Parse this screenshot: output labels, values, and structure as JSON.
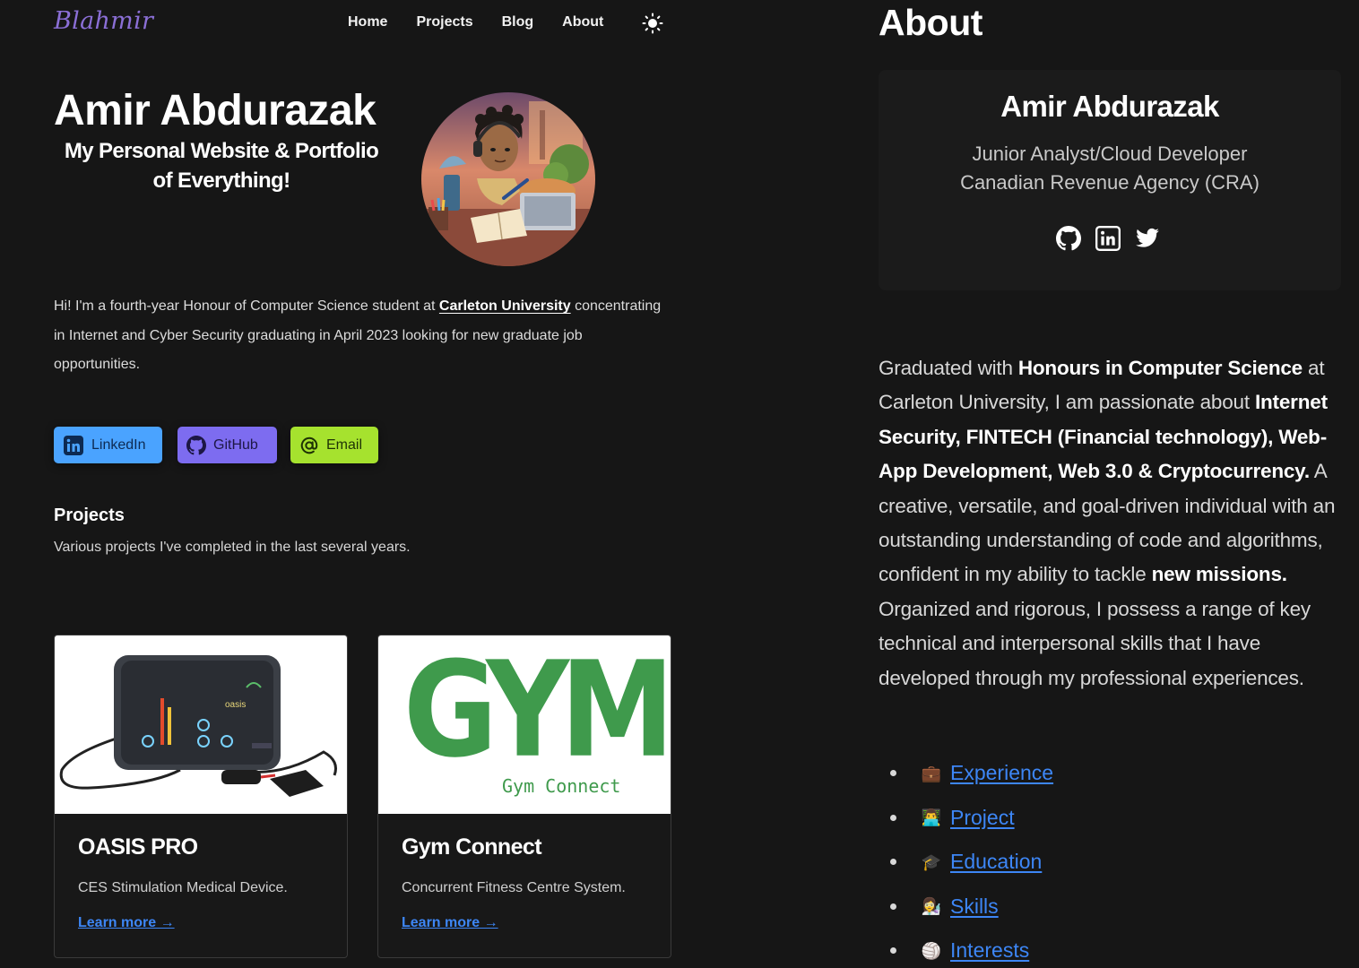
{
  "nav": {
    "brand": "Blahmir",
    "items": [
      "Home",
      "Projects",
      "Blog",
      "About"
    ],
    "theme_icon": "sun-icon"
  },
  "hero": {
    "name": "Amir Abdurazak",
    "subtitle_line1": "My Personal Website & Portfolio",
    "subtitle_line2": "of Everything!",
    "intro_before": "Hi! I'm a fourth-year Honour of Computer Science student at ",
    "intro_link": "Carleton University",
    "intro_after": " concentrating in Internet and Cyber Security graduating in April 2023 looking for new graduate job opportunities."
  },
  "buttons": {
    "linkedin": "LinkedIn",
    "github": "GitHub",
    "email": "Email"
  },
  "projects": {
    "heading": "Projects",
    "description": "Various projects I've completed in the last several years.",
    "cards": [
      {
        "title": "OASIS PRO",
        "description": "CES Stimulation Medical Device.",
        "link": "Learn more →"
      },
      {
        "title": "Gym Connect",
        "description": "Concurrent Fitness Centre System.",
        "link": "Learn more →",
        "logo_text": "GYM",
        "logo_sub": "Gym Connect"
      }
    ]
  },
  "about": {
    "heading": "About",
    "profile": {
      "name": "Amir Abdurazak",
      "role": "Junior Analyst/Cloud Developer",
      "org": "Canadian Revenue Agency (CRA)",
      "icons": [
        "github-icon",
        "linkedin-icon",
        "twitter-icon"
      ]
    },
    "bio": {
      "p1": "Graduated with ",
      "b1": "Honours in Computer Science",
      "p2": " at Carleton University, I am passionate about ",
      "b2": "Internet Security, FINTECH (Financial technology), Web-App Development, Web 3.0 & Cryptocurrency.",
      "p3": " A creative, versatile, and goal-driven individual with an outstanding understanding of code and algorithms, confident in my ability to tackle ",
      "b3": "new missions.",
      "p4": " Organized and rigorous, I possess a range of key technical and interpersonal skills that I have developed through my professional experiences."
    },
    "links": [
      {
        "label": "Experience",
        "emoji": "💼"
      },
      {
        "label": "Project",
        "emoji": "👨‍💻"
      },
      {
        "label": "Education",
        "emoji": "🎓"
      },
      {
        "label": "Skills",
        "emoji": "👩‍🔬"
      },
      {
        "label": "Interests",
        "emoji": "🏐"
      }
    ]
  },
  "colors": {
    "background": "#161616",
    "brand": "#8b6fd6",
    "link": "#3d86f5",
    "linkedin_btn": "#4aa3ff",
    "github_btn": "#7d6cf0",
    "email_btn": "#a6e22e",
    "gym_green": "#3f9a4c"
  }
}
